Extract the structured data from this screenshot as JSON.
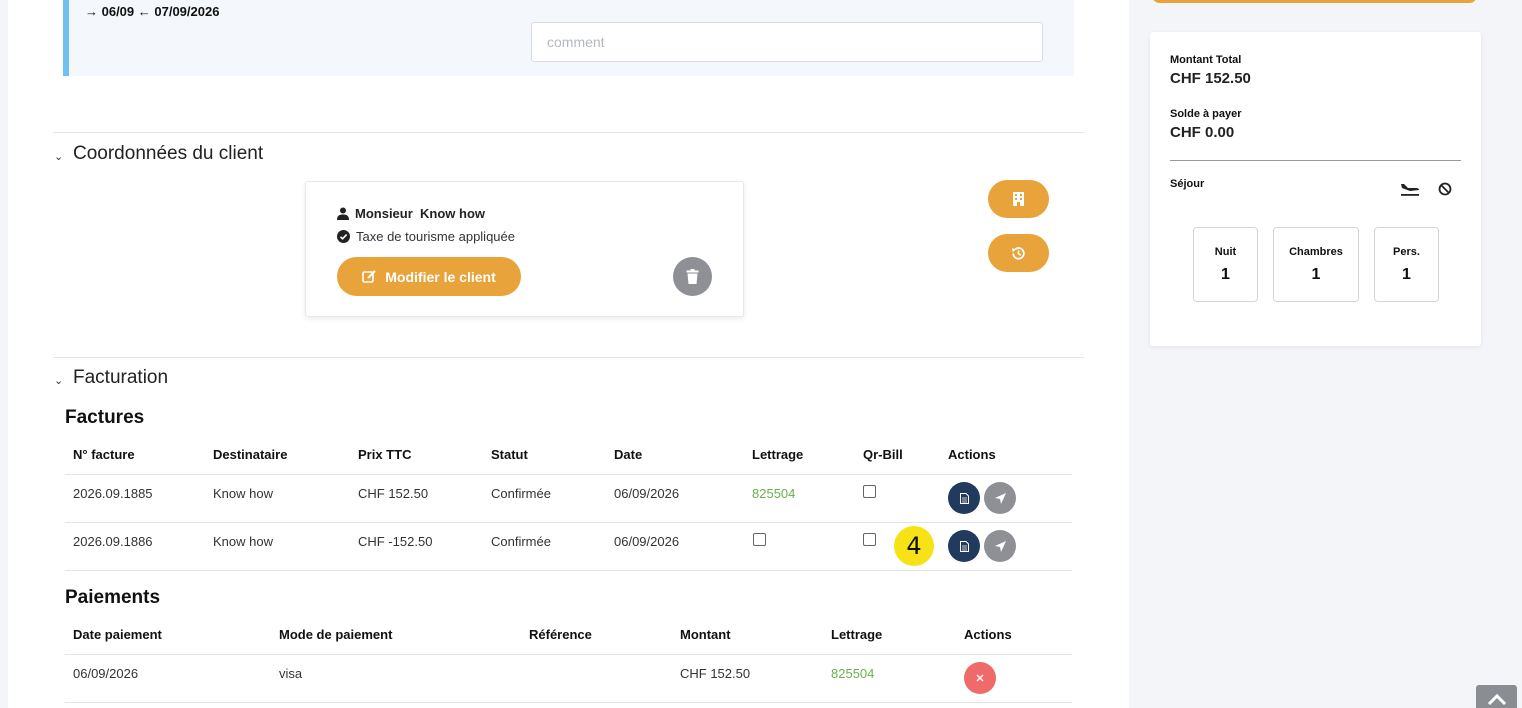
{
  "stay": {
    "dates": "→ 06/09 ← 07/09/2026",
    "comment_placeholder": "comment"
  },
  "client_section": {
    "title": "Coordonnées du client",
    "client_name": "Monsieur  Know how",
    "tax_note": "Taxe de tourisme appliquée",
    "modify_label": "Modifier le client"
  },
  "billing_section": {
    "title": "Facturation",
    "invoices_title": "Factures",
    "invoice_headers": [
      "N° facture",
      "Destinataire",
      "Prix TTC",
      "Statut",
      "Date",
      "Lettrage",
      "Qr-Bill",
      "Actions"
    ],
    "invoices": [
      {
        "number": "2026.09.1885",
        "recipient": "Know how",
        "price": "CHF 152.50",
        "status": "Confirmée",
        "date": "06/09/2026",
        "lettrage": "825504",
        "qr_bill": false
      },
      {
        "number": "2026.09.1886",
        "recipient": "Know how",
        "price": "CHF -152.50",
        "status": "Confirmée",
        "date": "06/09/2026",
        "lettrage": "",
        "qr_bill": false
      }
    ],
    "payments_title": "Paiements",
    "payment_headers": [
      "Date paiement",
      "Mode de paiement",
      "Référence",
      "Montant",
      "Lettrage",
      "Actions"
    ],
    "payments": [
      {
        "date": "06/09/2026",
        "mode": "visa",
        "reference": "",
        "amount": "CHF 152.50",
        "lettrage": "825504"
      }
    ]
  },
  "badge": {
    "number": "4"
  },
  "summary": {
    "total_label": "Montant Total",
    "total_value": "CHF 152.50",
    "balance_label": "Solde à payer",
    "balance_value": "CHF 0.00",
    "stay_label": "Séjour",
    "stats": [
      {
        "label": "Nuit",
        "value": "1"
      },
      {
        "label": "Chambres",
        "value": "1"
      },
      {
        "label": "Pers.",
        "value": "1"
      }
    ]
  },
  "colors": {
    "accent": "#e8a33a",
    "navy": "#223a5e",
    "green": "#6ab04c",
    "danger": "#ef6a6a",
    "stay_border": "#6ec1f0"
  },
  "icons": [
    "user-icon",
    "check-circle-icon",
    "edit-icon",
    "trash-icon",
    "building-icon",
    "history-icon",
    "document-icon",
    "send-icon",
    "close-icon",
    "plane-landing-icon",
    "ban-icon",
    "chevron-up-icon",
    "chevron-down-icon"
  ]
}
